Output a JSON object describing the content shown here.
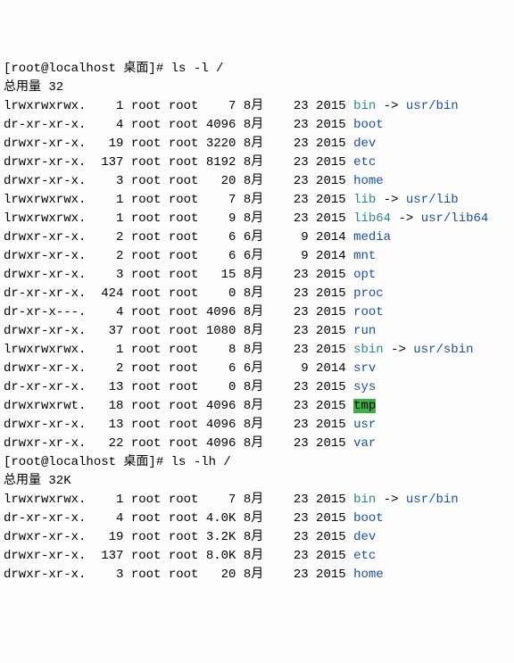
{
  "prompt1": "[root@localhost 桌面]# ",
  "cmd1": "ls -l /",
  "total1": "总用量 32",
  "rows1": [
    {
      "perm": "lrwxrwxrwx.",
      "lk": "1",
      "o": "root",
      "g": "root",
      "sz": "7",
      "m": "8月",
      "d": "23",
      "y": "2015",
      "name": "bin",
      "class": "link",
      "arrow": " -> ",
      "target": "usr/bin"
    },
    {
      "perm": "dr-xr-xr-x.",
      "lk": "4",
      "o": "root",
      "g": "root",
      "sz": "4096",
      "m": "8月",
      "d": "23",
      "y": "2015",
      "name": "boot",
      "class": "dir"
    },
    {
      "perm": "drwxr-xr-x.",
      "lk": "19",
      "o": "root",
      "g": "root",
      "sz": "3220",
      "m": "8月",
      "d": "23",
      "y": "2015",
      "name": "dev",
      "class": "dir"
    },
    {
      "perm": "drwxr-xr-x.",
      "lk": "137",
      "o": "root",
      "g": "root",
      "sz": "8192",
      "m": "8月",
      "d": "23",
      "y": "2015",
      "name": "etc",
      "class": "dir"
    },
    {
      "perm": "drwxr-xr-x.",
      "lk": "3",
      "o": "root",
      "g": "root",
      "sz": "20",
      "m": "8月",
      "d": "23",
      "y": "2015",
      "name": "home",
      "class": "dir"
    },
    {
      "perm": "lrwxrwxrwx.",
      "lk": "1",
      "o": "root",
      "g": "root",
      "sz": "7",
      "m": "8月",
      "d": "23",
      "y": "2015",
      "name": "lib",
      "class": "link",
      "arrow": " -> ",
      "target": "usr/lib"
    },
    {
      "perm": "lrwxrwxrwx.",
      "lk": "1",
      "o": "root",
      "g": "root",
      "sz": "9",
      "m": "8月",
      "d": "23",
      "y": "2015",
      "name": "lib64",
      "class": "link",
      "arrow": " -> ",
      "target": "usr/lib64"
    },
    {
      "perm": "drwxr-xr-x.",
      "lk": "2",
      "o": "root",
      "g": "root",
      "sz": "6",
      "m": "6月",
      "d": "9",
      "y": "2014",
      "name": "media",
      "class": "dir"
    },
    {
      "perm": "drwxr-xr-x.",
      "lk": "2",
      "o": "root",
      "g": "root",
      "sz": "6",
      "m": "6月",
      "d": "9",
      "y": "2014",
      "name": "mnt",
      "class": "dir"
    },
    {
      "perm": "drwxr-xr-x.",
      "lk": "3",
      "o": "root",
      "g": "root",
      "sz": "15",
      "m": "8月",
      "d": "23",
      "y": "2015",
      "name": "opt",
      "class": "dir"
    },
    {
      "perm": "dr-xr-xr-x.",
      "lk": "424",
      "o": "root",
      "g": "root",
      "sz": "0",
      "m": "8月",
      "d": "23",
      "y": "2015",
      "name": "proc",
      "class": "dir"
    },
    {
      "perm": "dr-xr-x---.",
      "lk": "4",
      "o": "root",
      "g": "root",
      "sz": "4096",
      "m": "8月",
      "d": "23",
      "y": "2015",
      "name": "root",
      "class": "dir"
    },
    {
      "perm": "drwxr-xr-x.",
      "lk": "37",
      "o": "root",
      "g": "root",
      "sz": "1080",
      "m": "8月",
      "d": "23",
      "y": "2015",
      "name": "run",
      "class": "dir"
    },
    {
      "perm": "lrwxrwxrwx.",
      "lk": "1",
      "o": "root",
      "g": "root",
      "sz": "8",
      "m": "8月",
      "d": "23",
      "y": "2015",
      "name": "sbin",
      "class": "link",
      "arrow": " -> ",
      "target": "usr/sbin"
    },
    {
      "perm": "drwxr-xr-x.",
      "lk": "2",
      "o": "root",
      "g": "root",
      "sz": "6",
      "m": "6月",
      "d": "9",
      "y": "2014",
      "name": "srv",
      "class": "dir"
    },
    {
      "perm": "dr-xr-xr-x.",
      "lk": "13",
      "o": "root",
      "g": "root",
      "sz": "0",
      "m": "8月",
      "d": "23",
      "y": "2015",
      "name": "sys",
      "class": "dir"
    },
    {
      "perm": "drwxrwxrwt.",
      "lk": "18",
      "o": "root",
      "g": "root",
      "sz": "4096",
      "m": "8月",
      "d": "23",
      "y": "2015",
      "name": "tmp",
      "class": "hl"
    },
    {
      "perm": "drwxr-xr-x.",
      "lk": "13",
      "o": "root",
      "g": "root",
      "sz": "4096",
      "m": "8月",
      "d": "23",
      "y": "2015",
      "name": "usr",
      "class": "dir"
    },
    {
      "perm": "drwxr-xr-x.",
      "lk": "22",
      "o": "root",
      "g": "root",
      "sz": "4096",
      "m": "8月",
      "d": "23",
      "y": "2015",
      "name": "var",
      "class": "dir"
    }
  ],
  "prompt2": "[root@localhost 桌面]# ",
  "cmd2": "ls -lh /",
  "total2": "总用量 32K",
  "rows2": [
    {
      "perm": "lrwxrwxrwx.",
      "lk": "1",
      "o": "root",
      "g": "root",
      "sz": "7",
      "m": "8月",
      "d": "23",
      "y": "2015",
      "name": "bin",
      "class": "link",
      "arrow": " -> ",
      "target": "usr/bin"
    },
    {
      "perm": "dr-xr-xr-x.",
      "lk": "4",
      "o": "root",
      "g": "root",
      "sz": "4.0K",
      "m": "8月",
      "d": "23",
      "y": "2015",
      "name": "boot",
      "class": "dir"
    },
    {
      "perm": "drwxr-xr-x.",
      "lk": "19",
      "o": "root",
      "g": "root",
      "sz": "3.2K",
      "m": "8月",
      "d": "23",
      "y": "2015",
      "name": "dev",
      "class": "dir"
    },
    {
      "perm": "drwxr-xr-x.",
      "lk": "137",
      "o": "root",
      "g": "root",
      "sz": "8.0K",
      "m": "8月",
      "d": "23",
      "y": "2015",
      "name": "etc",
      "class": "dir"
    },
    {
      "perm": "drwxr-xr-x.",
      "lk": "3",
      "o": "root",
      "g": "root",
      "sz": "20",
      "m": "8月",
      "d": "23",
      "y": "2015",
      "name": "home",
      "class": "dir"
    }
  ]
}
